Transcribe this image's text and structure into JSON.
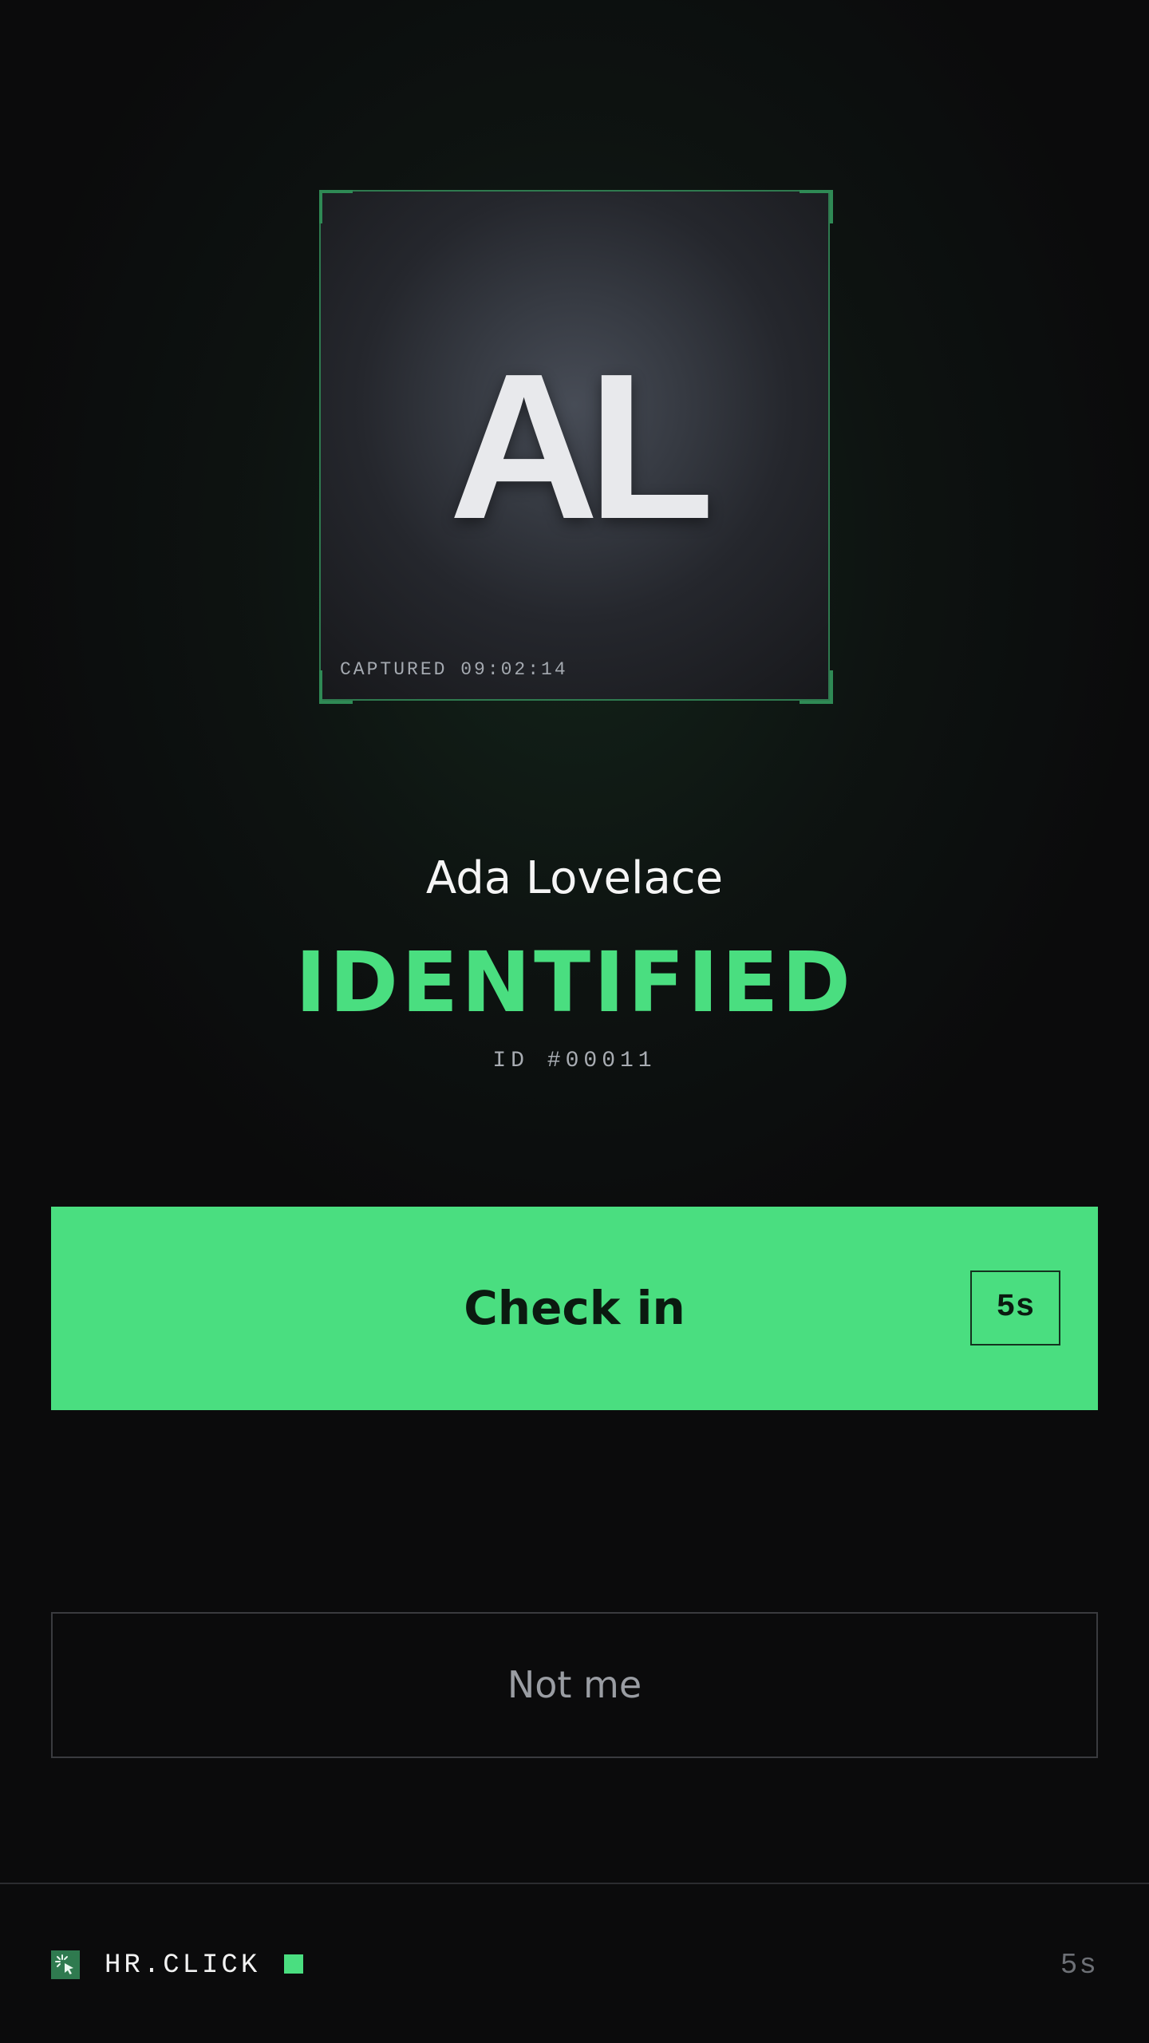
{
  "profile": {
    "initials": "AL",
    "captured_label": "CAPTURED 09:02:14",
    "name": "Ada Lovelace",
    "status": "IDENTIFIED",
    "employee_id": "ID #00011"
  },
  "actions": {
    "checkin_label": "Check in",
    "countdown": "5s",
    "not_me_label": "Not me"
  },
  "footer": {
    "brand": "HR.CLICK",
    "countdown": "5s",
    "logo_icon": "sparkle-cursor-icon",
    "status_indicator": "live-status-square"
  },
  "colors": {
    "accent": "#4ade80",
    "accent_dark": "#2f7a4f",
    "background": "#0b0b0c",
    "muted_text": "#9a9da3"
  }
}
